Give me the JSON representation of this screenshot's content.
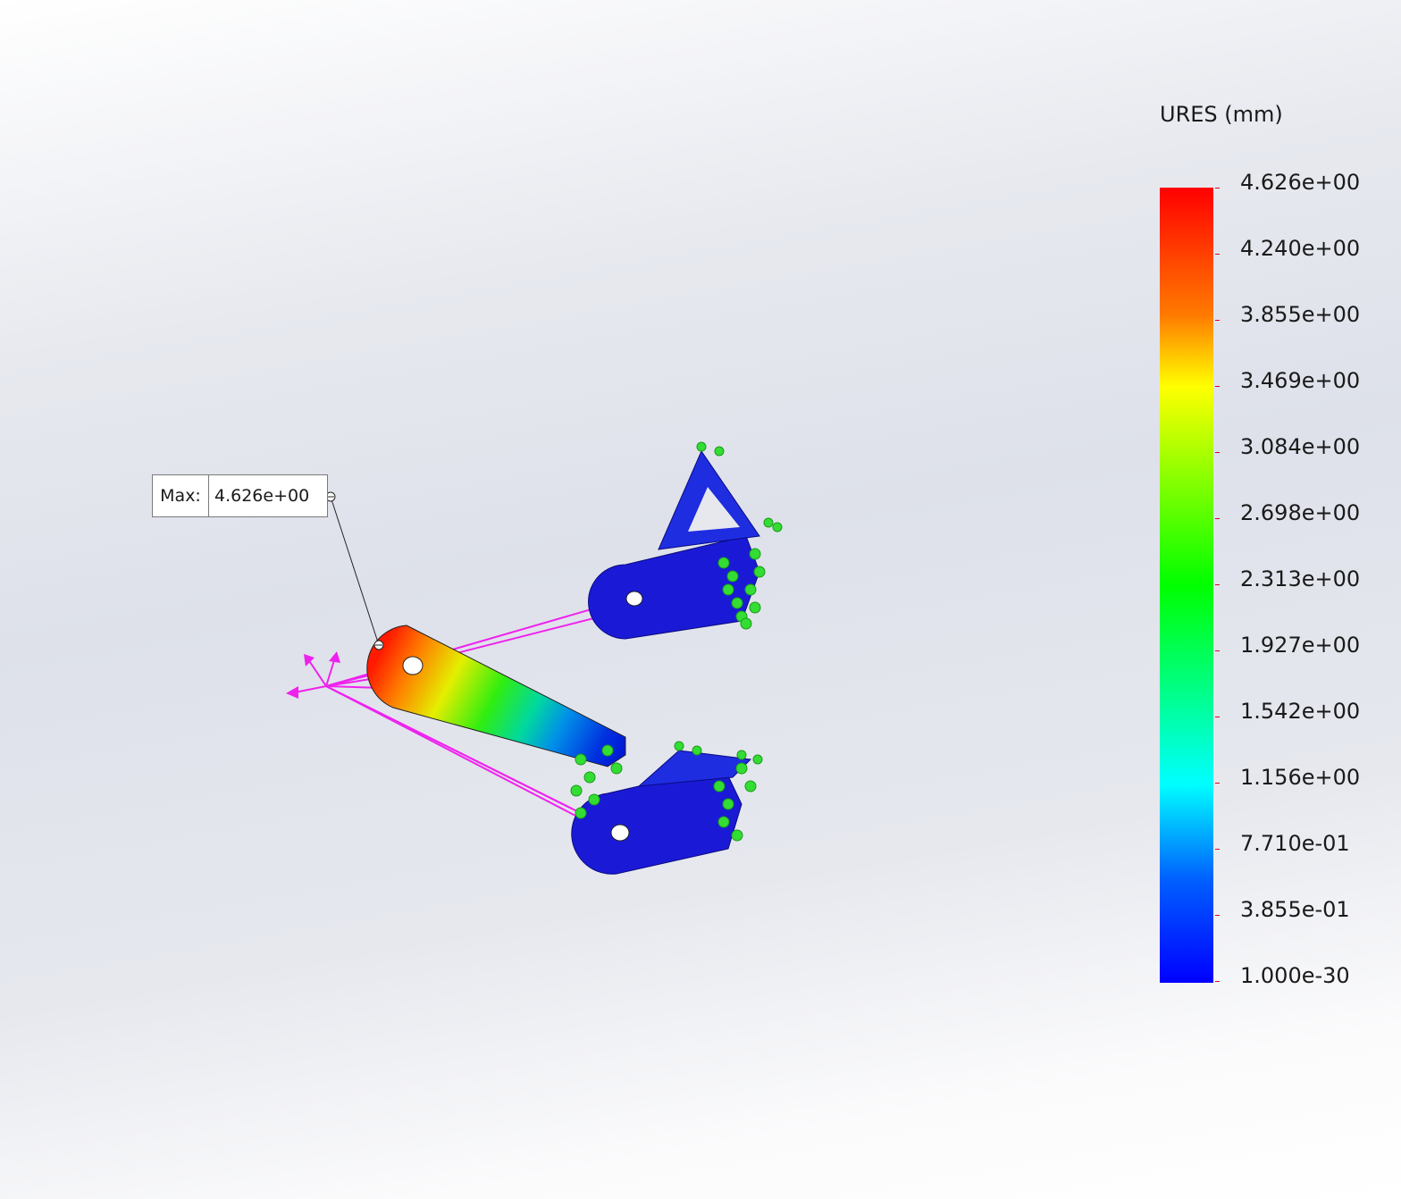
{
  "legend": {
    "title": "URES (mm)",
    "labels": [
      "4.626e+00",
      "4.240e+00",
      "3.855e+00",
      "3.469e+00",
      "3.084e+00",
      "2.698e+00",
      "2.313e+00",
      "1.927e+00",
      "1.542e+00",
      "1.156e+00",
      "7.710e-01",
      "3.855e-01",
      "1.000e-30"
    ],
    "colors": {
      "max": "#ff0000",
      "high": "#ff7a00",
      "mid_high": "#ffff00",
      "mid": "#00ff00",
      "mid_low": "#00ffff",
      "min": "#0000ff"
    }
  },
  "annotation": {
    "label": "Max:",
    "value": "4.626e+00"
  },
  "model": {
    "fixture_color": "#33dd33",
    "load_color": "#ee22ee",
    "part_color": "#1a1ad6"
  }
}
